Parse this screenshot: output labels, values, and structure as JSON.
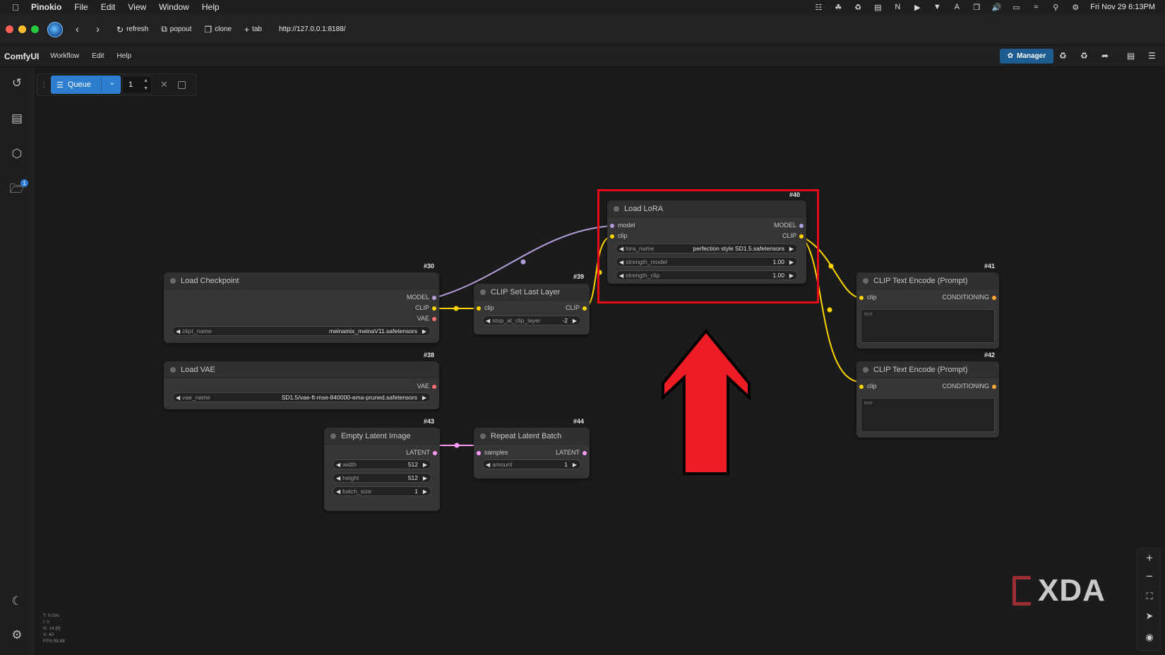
{
  "menubar": {
    "app": "Pinokio",
    "items": [
      "File",
      "Edit",
      "View",
      "Window",
      "Help"
    ],
    "datetime": "Fri Nov 29  6:13PM"
  },
  "toolbar": {
    "refresh": "refresh",
    "popout": "popout",
    "clone": "clone",
    "tab": "tab",
    "url": "http://127.0.0.1:8188/"
  },
  "comfy": {
    "brand": "ComfyUI",
    "menus": [
      "Workflow",
      "Edit",
      "Help"
    ],
    "manager": "Manager"
  },
  "queue": {
    "label": "Queue",
    "count": "1"
  },
  "nodes": {
    "load_checkpoint": {
      "id": "#30",
      "title": "Load Checkpoint",
      "outputs": [
        "MODEL",
        "CLIP",
        "VAE"
      ],
      "widget_label": "ckpt_name",
      "widget_value": "meinamix_meinaV11.safetensors"
    },
    "load_vae": {
      "id": "#38",
      "title": "Load VAE",
      "outputs": [
        "VAE"
      ],
      "widget_label": "vae_name",
      "widget_value": "SD1.5/vae-ft-mse-840000-ema-pruned.safetensors"
    },
    "clip_set_last_layer": {
      "id": "#39",
      "title": "CLIP Set Last Layer",
      "input": "clip",
      "output": "CLIP",
      "widget_label": "stop_at_clip_layer",
      "widget_value": "-2"
    },
    "load_lora": {
      "id": "#40",
      "title": "Load LoRA",
      "inputs": [
        "model",
        "clip"
      ],
      "outputs": [
        "MODEL",
        "CLIP"
      ],
      "widgets": [
        {
          "label": "lora_name",
          "value": "perfection style SD1.5.safetensors"
        },
        {
          "label": "strength_model",
          "value": "1.00"
        },
        {
          "label": "strength_clip",
          "value": "1.00"
        }
      ]
    },
    "clip_text_encode_1": {
      "id": "#41",
      "title": "CLIP Text Encode (Prompt)",
      "input": "clip",
      "output": "CONDITIONING",
      "placeholder": "text"
    },
    "clip_text_encode_2": {
      "id": "#42",
      "title": "CLIP Text Encode (Prompt)",
      "input": "clip",
      "output": "CONDITIONING",
      "placeholder": "text"
    },
    "empty_latent": {
      "id": "#43",
      "title": "Empty Latent Image",
      "output": "LATENT",
      "widgets": [
        {
          "label": "width",
          "value": "512"
        },
        {
          "label": "height",
          "value": "512"
        },
        {
          "label": "batch_size",
          "value": "1"
        }
      ]
    },
    "repeat_latent": {
      "id": "#44",
      "title": "Repeat Latent Batch",
      "input": "samples",
      "output": "LATENT",
      "widget_label": "amount",
      "widget_value": "1"
    }
  },
  "stats": [
    "T: 0.00s",
    "I: 0",
    "N: 14 [8]",
    "V: 40",
    "FPS:59.88"
  ],
  "watermark": "XDA",
  "colors": {
    "model_wire": "#b39ddb",
    "clip_wire": "#ffd500",
    "latent_wire": "#ff9cf9",
    "vae_pin": "#ff6e6e",
    "highlight": "#e50c18",
    "accent": "#2e7ecf"
  }
}
